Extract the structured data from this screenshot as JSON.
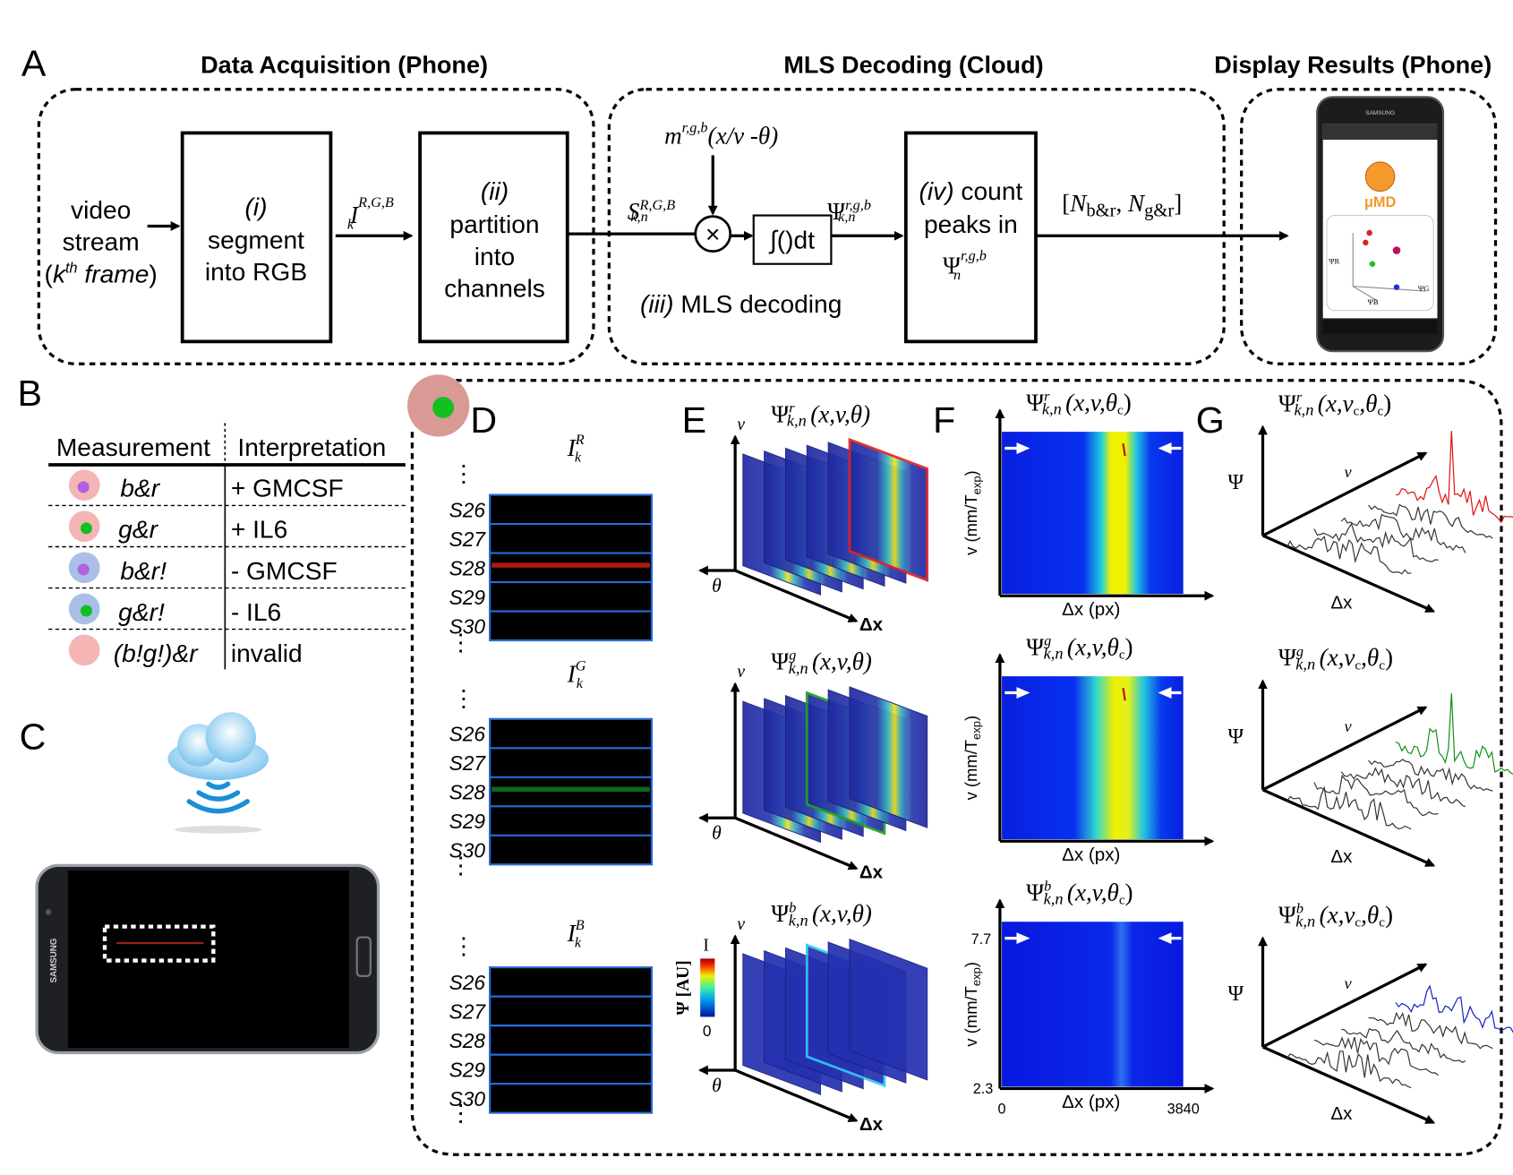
{
  "panel_labels": {
    "a": "A",
    "b": "B",
    "c": "C",
    "d": "D",
    "e": "E",
    "f": "F",
    "g": "G"
  },
  "section_titles": {
    "acquisition": "Data Acquisition (Phone)",
    "decoding": "MLS Decoding (Cloud)",
    "display": "Display Results (Phone)"
  },
  "pipeline": {
    "input": {
      "line1": "video",
      "line2": "stream",
      "open": "(",
      "k": "k",
      "th": "th",
      "frame": " frame",
      ")": ")"
    },
    "step1": {
      "num": "(i)",
      "line1": "segment",
      "line2": "into RGB"
    },
    "i_label": {
      "base": "I",
      "sub": "k",
      "sup": "R,G,B"
    },
    "step2": {
      "num": "(ii)",
      "line1": "partition",
      "line2": "into",
      "line3": "channels"
    },
    "s_label": {
      "base": "S",
      "sub": "k,n",
      "sup": "R,G,B"
    },
    "m_label": {
      "base": "m",
      "sup": "r,g,b",
      "args": "(x/v -θ)"
    },
    "multiply_symbol": "×",
    "integrate_label": "∫()dt",
    "psi_label": {
      "base": "Ψ",
      "sub": "k,n",
      "sup": "r,g,b"
    },
    "step3": {
      "num": "(iii)",
      "text": " MLS decoding"
    },
    "step4": {
      "num": "(iv)",
      "line1": " count",
      "line2": "peaks in",
      "psi_base": "Ψ",
      "psi_sub": "n",
      "psi_sup": "r,g,b"
    },
    "output": {
      "open": "[",
      "n1": "N",
      "n1_sub": "b&r",
      "sep": ", ",
      "n2": "N",
      "n2_sub": "g&r",
      "close": "]"
    }
  },
  "phone_display": {
    "brand": "SAMSUNG",
    "app_name": "μMD",
    "axis_r": "ΨR",
    "axis_g": "ΨG",
    "axis_b": "ΨB"
  },
  "table": {
    "headers": [
      "Measurement",
      "Interpretation"
    ],
    "rows": [
      {
        "measurement": "b&r",
        "interpretation": "+ GMCSF",
        "bead": "#f5b5b5",
        "dot": "#b060e0"
      },
      {
        "measurement": "g&r",
        "interpretation": "+ IL6",
        "bead": "#f5b5b5",
        "dot": "#10c020"
      },
      {
        "measurement": "b&r!",
        "interpretation": "- GMCSF",
        "bead": "#a9bfe6",
        "dot": "#b060e0"
      },
      {
        "measurement": "g&r!",
        "interpretation": "- IL6",
        "bead": "#a9bfe6",
        "dot": "#10c020"
      },
      {
        "measurement": "(b!g!)&r",
        "interpretation": "invalid",
        "bead": "#f5b5b5",
        "dot": ""
      }
    ]
  },
  "panel_c": {
    "phone_brand": "SAMSUNG"
  },
  "panel_d": {
    "images": [
      {
        "base": "I",
        "sub": "k",
        "sup": "R",
        "stripe_color": "#d02010"
      },
      {
        "base": "I",
        "sub": "k",
        "sup": "G",
        "stripe_color": "#107a20"
      },
      {
        "base": "I",
        "sub": "k",
        "sup": "B",
        "stripe_color": ""
      }
    ],
    "rows": [
      "S26",
      "S27",
      "S28",
      "S29",
      "S30"
    ],
    "ellipsis": "⋮"
  },
  "panel_e": {
    "plots": [
      {
        "base": "Ψ",
        "sup": "r",
        "sub": "k,n",
        "args": "(x,v,θ)",
        "outline": "#e02020"
      },
      {
        "base": "Ψ",
        "sup": "g",
        "sub": "k,n",
        "args": "(x,v,θ)",
        "outline": "#20a020"
      },
      {
        "base": "Ψ",
        "sup": "b",
        "sub": "k,n",
        "args": "(x,v,θ)",
        "outline": "#30c8f0"
      }
    ],
    "axis_v": "v",
    "axis_theta": "θ",
    "axis_dx": "Δx",
    "colorbar": {
      "label": "Ψ [AU]",
      "min": "0",
      "max": "I"
    }
  },
  "panel_f": {
    "plots": [
      {
        "base": "Ψ",
        "sup": "r",
        "sub": "k,n",
        "args": "(x,v,θ",
        "args_sub": "c",
        "close": ")"
      },
      {
        "base": "Ψ",
        "sup": "g",
        "sub": "k,n",
        "args": "(x,v,θ",
        "args_sub": "c",
        "close": ")"
      },
      {
        "base": "Ψ",
        "sup": "b",
        "sub": "k,n",
        "args": "(x,v,θ",
        "args_sub": "c",
        "close": ")"
      }
    ],
    "ylabel": "v (mm/T",
    "ylabel_sub": "exp",
    "ylabel_close": ")",
    "xlabel": "Δx (px)",
    "y_ticks": [
      "7.7",
      "2.3"
    ],
    "x_ticks": [
      "0",
      "3840"
    ]
  },
  "panel_g": {
    "plots": [
      {
        "base": "Ψ",
        "sup": "r",
        "sub": "k,n",
        "args": "(x,v",
        "args_sub": "c",
        "args2": ",θ",
        "args2_sub": "c",
        "close": ")",
        "color": "#e01010"
      },
      {
        "base": "Ψ",
        "sup": "g",
        "sub": "k,n",
        "args": "(x,v",
        "args_sub": "c",
        "args2": ",θ",
        "args2_sub": "c",
        "close": ")",
        "color": "#109010"
      },
      {
        "base": "Ψ",
        "sup": "b",
        "sub": "k,n",
        "args": "(x,v",
        "args_sub": "c",
        "args2": ",θ",
        "args2_sub": "c",
        "close": ")",
        "color": "#1020c0"
      }
    ],
    "axis_psi": "Ψ",
    "axis_v": "v",
    "axis_dx": "Δx"
  }
}
